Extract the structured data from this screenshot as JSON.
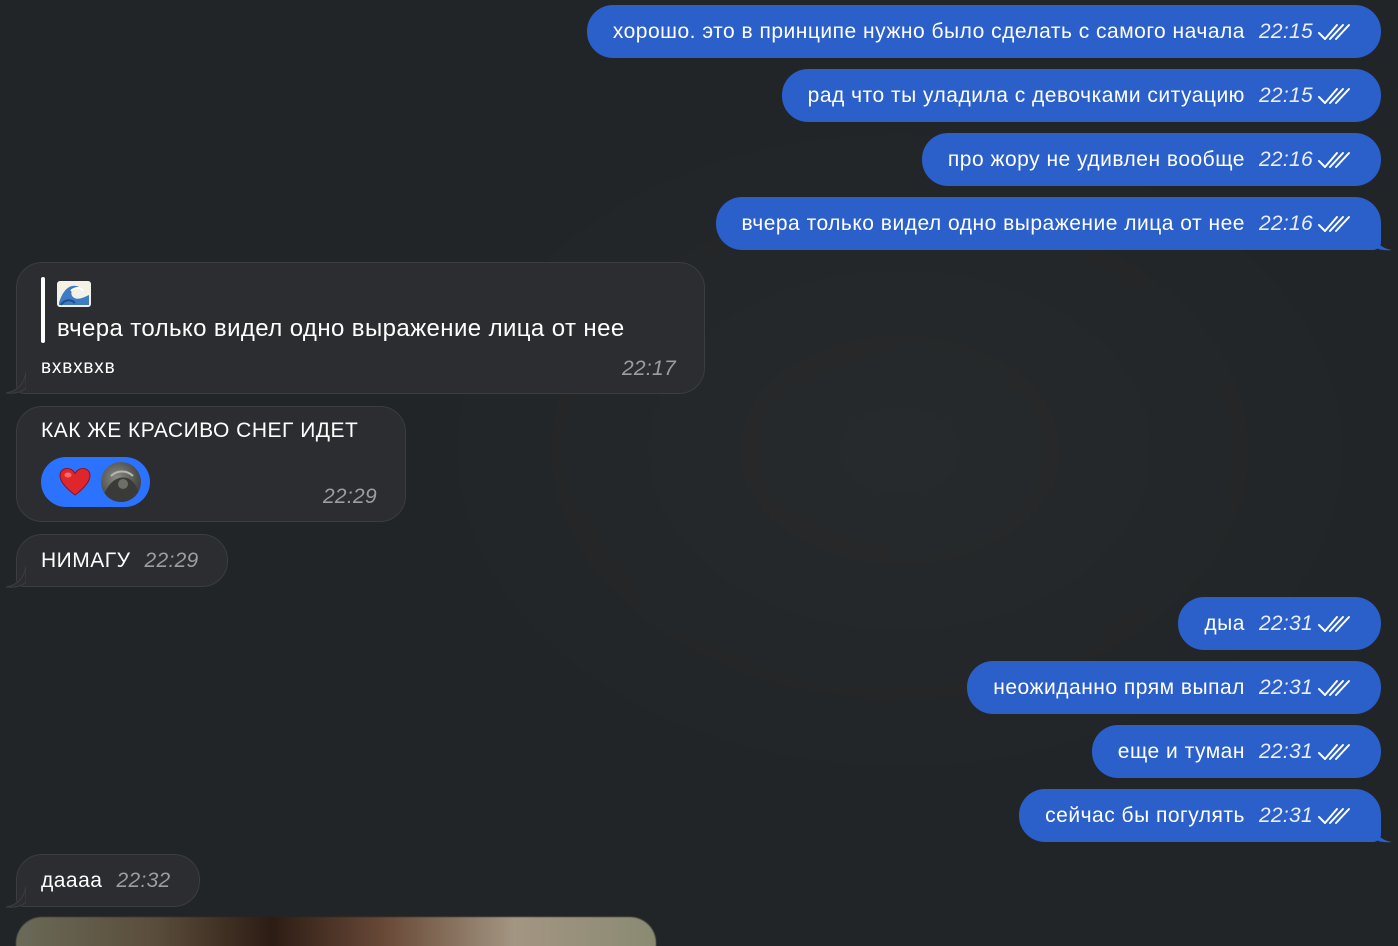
{
  "messages": {
    "m1": {
      "text": "хорошо. это в принципе нужно было сделать с самого начала",
      "time": "22:15"
    },
    "m2": {
      "text": "рад что ты уладила с девочками ситуацию",
      "time": "22:15"
    },
    "m3": {
      "text": "про жору не удивлен вообще",
      "time": "22:16"
    },
    "m4": {
      "text": "вчера только видел одно выражение лица от нее",
      "time": "22:16"
    },
    "reply": {
      "quote_text": "вчера только видел одно выражение лица от нее",
      "text": "вхвхвхв",
      "time": "22:17"
    },
    "snow": {
      "text": "КАК ЖЕ КРАСИВО СНЕГ ИДЕТ",
      "time": "22:29"
    },
    "nimagu": {
      "text": "НИМАГУ",
      "time": "22:29"
    },
    "m5": {
      "text": "дыа",
      "time": "22:31"
    },
    "m6": {
      "text": "неожиданно прям выпал",
      "time": "22:31"
    },
    "m7": {
      "text": "еще и туман",
      "time": "22:31"
    },
    "m8": {
      "text": "сейчас бы погулять",
      "time": "22:31"
    },
    "daaaa": {
      "text": "даааа",
      "time": "22:32"
    }
  },
  "colors": {
    "background": "#222527",
    "outgoing_bubble": "#2b5fca",
    "incoming_bubble": "#2b2d30",
    "reaction_pill": "#2b72ff"
  },
  "icons": {
    "read_receipt": "double-check-icon",
    "quote_emoji": "wave-emoji-icon",
    "reaction": "heart-icon"
  }
}
